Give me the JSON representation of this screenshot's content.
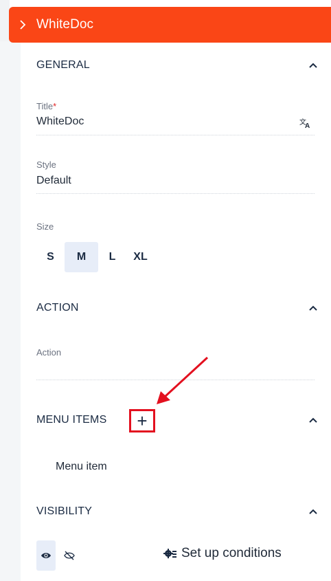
{
  "header": {
    "title": "WhiteDoc",
    "expand_icon": "chevron-right-icon"
  },
  "sections": {
    "general": {
      "title": "GENERAL"
    },
    "action": {
      "title": "ACTION"
    },
    "menu_items": {
      "title": "MENU ITEMS"
    },
    "visibility": {
      "title": "VISIBILITY"
    }
  },
  "fields": {
    "title": {
      "label": "Title",
      "required_mark": "*",
      "value": "WhiteDoc",
      "icon": "translate-icon"
    },
    "style": {
      "label": "Style",
      "value": "Default"
    },
    "size": {
      "label": "Size",
      "options": [
        "S",
        "M",
        "L",
        "XL"
      ],
      "selected": "M"
    },
    "action": {
      "label": "Action",
      "value": ""
    }
  },
  "menu_items": {
    "add_icon": "+",
    "items": [
      "Menu item"
    ]
  },
  "visibility": {
    "visible_icon": "eye-icon",
    "hidden_icon": "eye-off-icon",
    "selected": "visible",
    "conditions_label": "Set up conditions"
  },
  "colors": {
    "accent": "#fa4616",
    "highlight_red": "#e3101f",
    "selected_bg": "#e7edf8"
  }
}
